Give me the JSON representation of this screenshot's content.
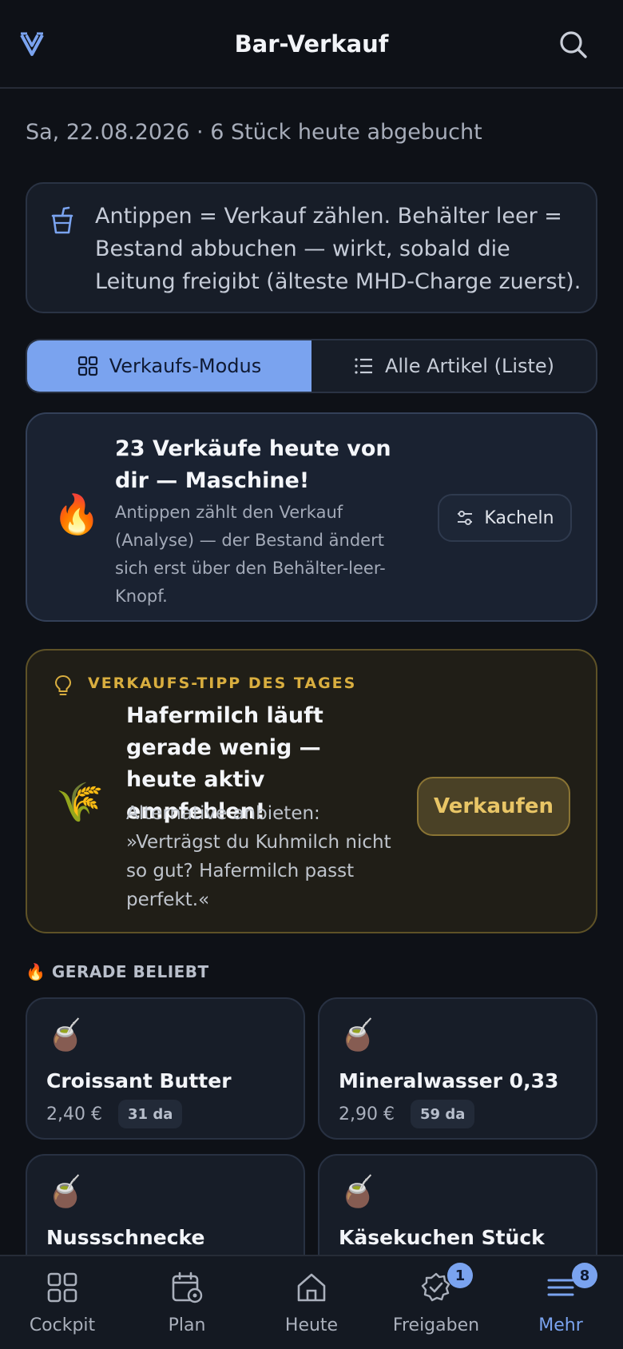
{
  "header": {
    "title": "Bar-Verkauf",
    "logo_icon": "diamond-chevron-logo",
    "search_icon": "search-icon"
  },
  "date_summary": "Sa, 22.08.2026 · 6 Stück heute abgebucht",
  "info_card": {
    "icon": "cup-icon",
    "text": "Antippen = Verkauf zählen. Behälter leer = Bestand abbuchen — wirkt, sobald die Leitung freigibt (älteste MHD-Charge zuerst)."
  },
  "mode_toggle": {
    "selected": "Verkaufs-Modus",
    "options": [
      {
        "label": "Verkaufs-Modus",
        "icon": "grid-icon"
      },
      {
        "label": "Alle Artikel (Liste)",
        "icon": "list-icon"
      }
    ]
  },
  "streak_card": {
    "emoji": "🔥",
    "headline": "23 Verkäufe heute von dir — Maschine!",
    "subtext": "Antippen zählt den Verkauf (Analyse) — der Bestand ändert sich erst über den Behälter-leer-Knopf.",
    "button_label": "Kacheln"
  },
  "tip_card": {
    "eyebrow": "VERKAUFS-TIPP DES TAGES",
    "emoji": "🌾",
    "headline": "Hafermilch läuft gerade wenig — heute aktiv empfehlen!",
    "body": "Alternative anbieten: »Verträgst du Kuhmilch nicht so gut? Hafermilch passt perfekt.«",
    "button_label": "Verkaufen"
  },
  "popular": {
    "label": "🔥 GERADE BELIEBT",
    "items": [
      {
        "emoji": "🧉",
        "name": "Croissant Butter",
        "price": "2,40 €",
        "stock": "31 da"
      },
      {
        "emoji": "🧉",
        "name": "Mineralwasser 0,33",
        "price": "2,90 €",
        "stock": "59 da"
      },
      {
        "emoji": "🧉",
        "name": "Nussschnecke",
        "price": "",
        "stock": ""
      },
      {
        "emoji": "🧉",
        "name": "Käsekuchen Stück",
        "price": "",
        "stock": ""
      }
    ]
  },
  "bottom_nav": {
    "active": "Mehr",
    "items": [
      {
        "label": "Cockpit",
        "icon": "dashboard-icon",
        "badge": ""
      },
      {
        "label": "Plan",
        "icon": "calendar-gear-icon",
        "badge": ""
      },
      {
        "label": "Heute",
        "icon": "home-icon",
        "badge": ""
      },
      {
        "label": "Freigaben",
        "icon": "approval-badge-icon",
        "badge": "1"
      },
      {
        "label": "Mehr",
        "icon": "menu-icon",
        "badge": "8"
      }
    ]
  },
  "colors": {
    "background": "#0e1117",
    "accent": "#7aa3ef",
    "tip_accent": "#d9ae3f"
  }
}
